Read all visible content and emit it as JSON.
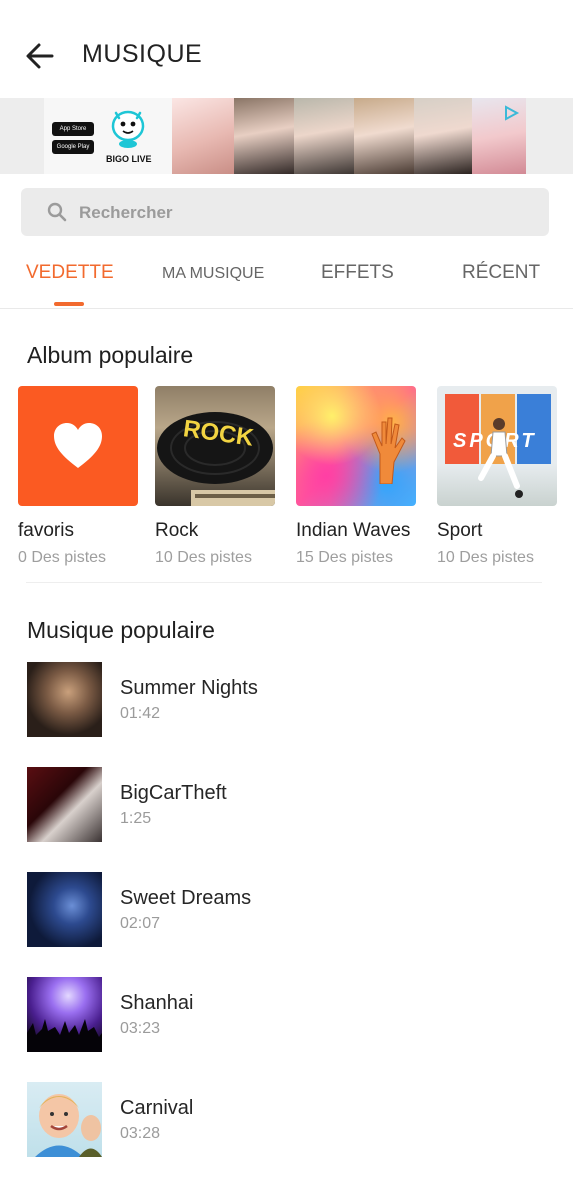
{
  "header": {
    "title": "MUSIQUE",
    "back_icon": "arrow-left-icon"
  },
  "ad_banner": {
    "brand": "BIGO LIVE",
    "app_store": "App Store",
    "google_play": "Google Play"
  },
  "search": {
    "placeholder": "Rechercher",
    "icon": "search-icon"
  },
  "tabs": [
    {
      "label": "VEDETTE",
      "active": true
    },
    {
      "label": "MA MUSIQUE",
      "active": false
    },
    {
      "label": "EFFETS",
      "active": false
    },
    {
      "label": "RÉCENT",
      "active": false
    }
  ],
  "albums_section": {
    "title": "Album populaire",
    "items": [
      {
        "name": "favoris",
        "count": "0 Des pistes",
        "cover": "heart-icon"
      },
      {
        "name": "Rock",
        "count": "10 Des pistes",
        "cover_text": "ROCK"
      },
      {
        "name": "Indian Waves",
        "count": "15 Des pistes"
      },
      {
        "name": "Sport",
        "count": "10 Des pistes",
        "cover_text": "SPORT"
      }
    ]
  },
  "tracks_section": {
    "title": "Musique populaire",
    "items": [
      {
        "title": "Summer Nights",
        "duration": "01:42"
      },
      {
        "title": "BigCarTheft",
        "duration": "1:25"
      },
      {
        "title": "Sweet Dreams",
        "duration": "02:07"
      },
      {
        "title": "Shanhai",
        "duration": "03:23"
      },
      {
        "title": "Carnival",
        "duration": "03:28"
      }
    ]
  },
  "colors": {
    "accent": "#f26a2e",
    "favoris_cover": "#fb5a22"
  }
}
